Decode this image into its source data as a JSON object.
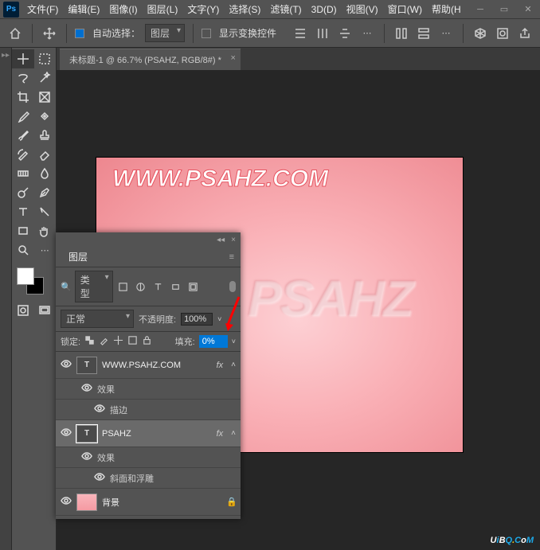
{
  "app": {
    "logo_text": "Ps"
  },
  "menu": {
    "file": "文件(F)",
    "edit": "编辑(E)",
    "image": "图像(I)",
    "layer": "图层(L)",
    "type": "文字(Y)",
    "select": "选择(S)",
    "filter": "滤镜(T)",
    "threeD": "3D(D)",
    "view": "视图(V)",
    "window": "窗口(W)",
    "help": "帮助(H"
  },
  "options": {
    "auto_select": "自动选择：",
    "target": "图层",
    "show_transform": "显示变换控件"
  },
  "document": {
    "tab_title": "未标题-1 @ 66.7% (PSAHZ, RGB/8#) *"
  },
  "canvas": {
    "text1": "WWW.PSAHZ.COM",
    "text2": "PSAHZ"
  },
  "layers_panel": {
    "title": "图层",
    "filter_label": "类型",
    "blend_mode": "正常",
    "opacity_label": "不透明度:",
    "opacity_value": "100%",
    "lock_label": "锁定:",
    "fill_label": "填充:",
    "fill_value": "0%",
    "layers": [
      {
        "name": "WWW.PSAHZ.COM",
        "fx": "fx",
        "effects": "效果",
        "sub": "描边"
      },
      {
        "name": "PSAHZ",
        "fx": "fx",
        "effects": "效果",
        "sub": "斜面和浮雕"
      },
      {
        "name": "背景"
      }
    ]
  },
  "watermark": {
    "text": "UiBQ.CoM"
  }
}
